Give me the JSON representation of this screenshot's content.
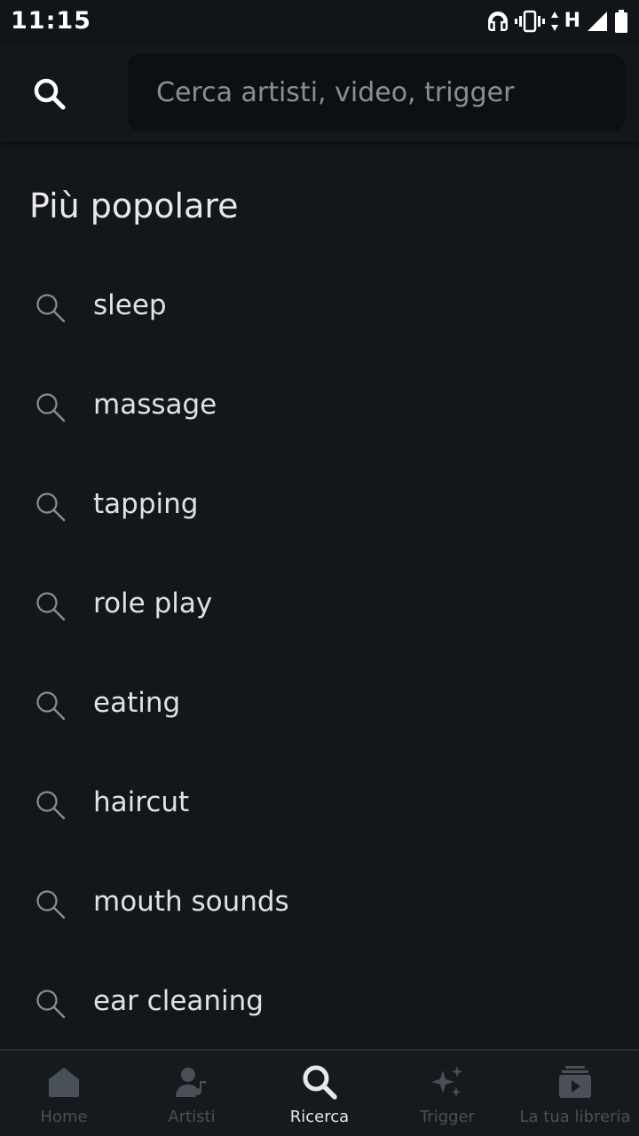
{
  "status_bar": {
    "time": "11:15",
    "network": "H",
    "icons": [
      "headphones-icon",
      "vibrate-icon",
      "data-arrows-icon",
      "signal-icon",
      "battery-icon"
    ]
  },
  "header": {
    "search_icon": "search-icon",
    "search_placeholder": "Cerca artisti, video, trigger",
    "search_value": ""
  },
  "popular": {
    "title": "Più popolare",
    "items": [
      {
        "label": "sleep",
        "icon": "search-icon"
      },
      {
        "label": "massage",
        "icon": "search-icon"
      },
      {
        "label": "tapping",
        "icon": "search-icon"
      },
      {
        "label": "role play",
        "icon": "search-icon"
      },
      {
        "label": "eating",
        "icon": "search-icon"
      },
      {
        "label": "haircut",
        "icon": "search-icon"
      },
      {
        "label": "mouth sounds",
        "icon": "search-icon"
      },
      {
        "label": "ear cleaning",
        "icon": "search-icon"
      }
    ]
  },
  "bottom_nav": {
    "items": [
      {
        "label": "Home",
        "icon": "home-icon",
        "active": false
      },
      {
        "label": "Artisti",
        "icon": "artist-icon",
        "active": false
      },
      {
        "label": "Ricerca",
        "icon": "search-icon",
        "active": true
      },
      {
        "label": "Trigger",
        "icon": "sparkle-icon",
        "active": false
      },
      {
        "label": "La tua libreria",
        "icon": "library-icon",
        "active": false
      }
    ]
  },
  "colors": {
    "background": "#13171c",
    "search_box": "#0d1013",
    "nav_inactive": "#4a5058",
    "nav_active": "#e8e8e8"
  }
}
